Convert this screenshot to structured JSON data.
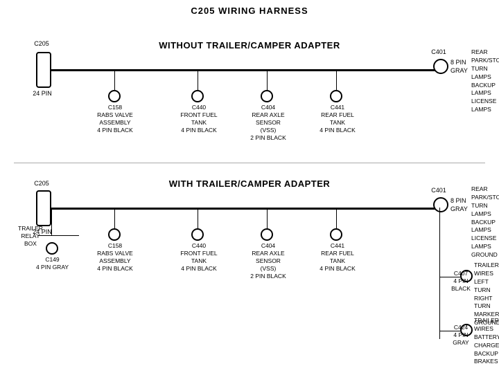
{
  "title": "C205 WIRING HARNESS",
  "top_section": {
    "label": "WITHOUT  TRAILER/CAMPER ADAPTER",
    "c205_label": "C205",
    "c205_pin": "24 PIN",
    "c401_label": "C401",
    "c401_pin": "8 PIN\nGRAY",
    "c401_desc": "REAR PARK/STOP\nTURN LAMPS\nBACKUP LAMPS\nLICENSE LAMPS",
    "connectors": [
      {
        "id": "C158",
        "label": "C158\nRABS VALVE\nASSEMBLY\n4 PIN BLACK"
      },
      {
        "id": "C440",
        "label": "C440\nFRONT FUEL\nTANK\n4 PIN BLACK"
      },
      {
        "id": "C404",
        "label": "C404\nREAR AXLE\nSENSOR\n(VSS)\n2 PIN BLACK"
      },
      {
        "id": "C441",
        "label": "C441\nREAR FUEL\nTANK\n4 PIN BLACK"
      }
    ]
  },
  "bottom_section": {
    "label": "WITH TRAILER/CAMPER ADAPTER",
    "c205_label": "C205",
    "c205_pin": "24 PIN",
    "c401_label": "C401",
    "c401_pin": "8 PIN\nGRAY",
    "c401_desc": "REAR PARK/STOP\nTURN LAMPS\nBACKUP LAMPS\nLICENSE LAMPS\nGROUND",
    "trailer_relay": "TRAILER\nRELAY\nBOX",
    "c149_label": "C149\n4 PIN GRAY",
    "c407_label": "C407\n4 PIN\nBLACK",
    "c407_desc": "TRAILER WIRES\nLEFT TURN\nRIGHT TURN\nMARKER\nGROUND",
    "c424_label": "C424\n4 PIN\nGRAY",
    "c424_desc": "TRAILER WIRES\nBATTERY CHARGE\nBACKUP\nBRAKES",
    "connectors": [
      {
        "id": "C158",
        "label": "C158\nRABS VALVE\nASSEMBLY\n4 PIN BLACK"
      },
      {
        "id": "C440",
        "label": "C440\nFRONT FUEL\nTANK\n4 PIN BLACK"
      },
      {
        "id": "C404",
        "label": "C404\nREAR AXLE\nSENSOR\n(VSS)\n2 PIN BLACK"
      },
      {
        "id": "C441",
        "label": "C441\nREAR FUEL\nTANK\n4 PIN BLACK"
      }
    ]
  }
}
